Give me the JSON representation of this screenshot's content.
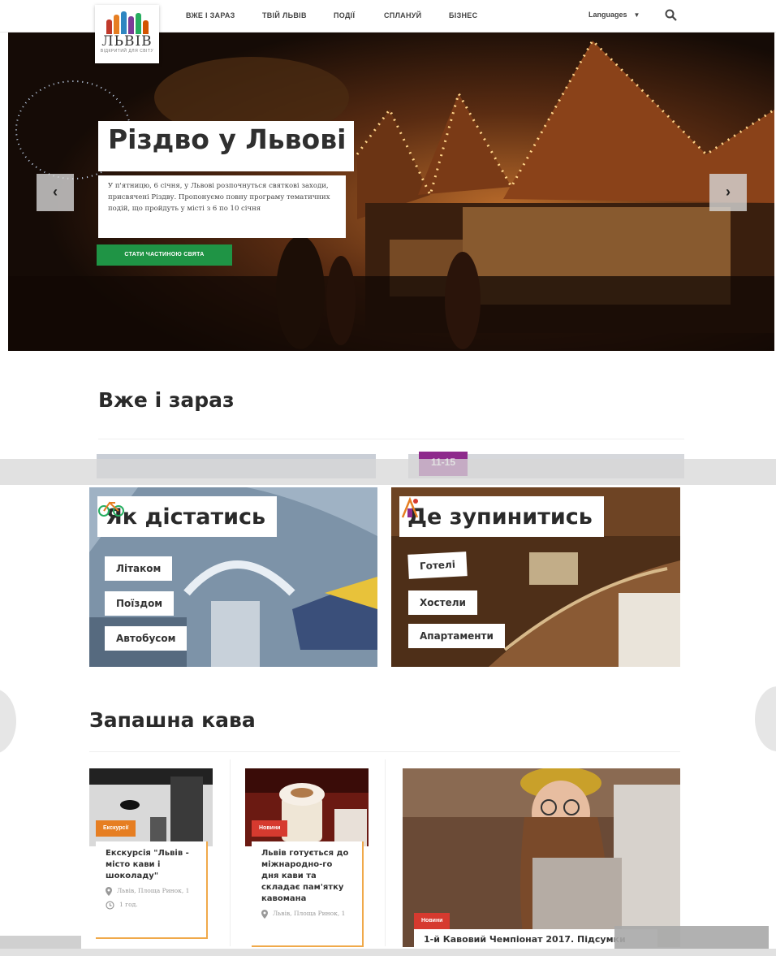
{
  "logo": {
    "word": "ЛЬВІВ",
    "sub": "ВІДКРИТИЙ ДЛЯ СВІТУ",
    "colors": [
      "#c0392b",
      "#e67e22",
      "#2e86c1",
      "#7d3c98",
      "#27ae60",
      "#d35400"
    ]
  },
  "nav": {
    "items": [
      "ВЖЕ І ЗАРАЗ",
      "ТВІЙ ЛЬВІВ",
      "ПОДІЇ",
      "СПЛАНУЙ",
      "БІЗНЕС"
    ],
    "language": "Languages",
    "accent": "#1f9445"
  },
  "hero": {
    "title": "Різдво у Львові",
    "text": "У п'ятницю, 6 січня, у Львові розпочнуться святкові заходи, присвячені Різдву. Пропонуємо повну програму тематичних подій, що пройдуть у місті з 6 по 10 січня",
    "cta": "СТАТИ ЧАСТИНОЮ СВЯТА",
    "prev": "‹",
    "next": "›",
    "slides": 4,
    "active_slide": 1
  },
  "section_now": {
    "title": "Вже і зараз",
    "date_badge": "11-15"
  },
  "travel": {
    "title": "Як дістатись",
    "icon": "bicycle-icon",
    "items": [
      "Літаком",
      "Поїздом",
      "Автобусом"
    ]
  },
  "stay": {
    "title": "Де зупинитись",
    "icon": "hotel-icon",
    "items": [
      "Готелі",
      "Хостели",
      "Апартаменти"
    ]
  },
  "coffee": {
    "title": "Запашна кава",
    "cards": [
      {
        "tag": "Екскурсії",
        "tag_color": "#e67e22",
        "title": "Екскурсія \"Львів - місто кави і шоколаду\"",
        "place": "Львів, Площа Ринок, 1",
        "time": "1 год."
      },
      {
        "tag": "Новини",
        "tag_color": "#d63a2f",
        "title": "Львів готується до міжнародно-го дня кави та складає пам'ятку кавомана",
        "place": "Львів, Площа Ринок, 1"
      },
      {
        "tag": "Новини",
        "tag_color": "#d63a2f",
        "title": "1-й Кавовий Чемпіонат 2017. Підсумки"
      }
    ]
  }
}
